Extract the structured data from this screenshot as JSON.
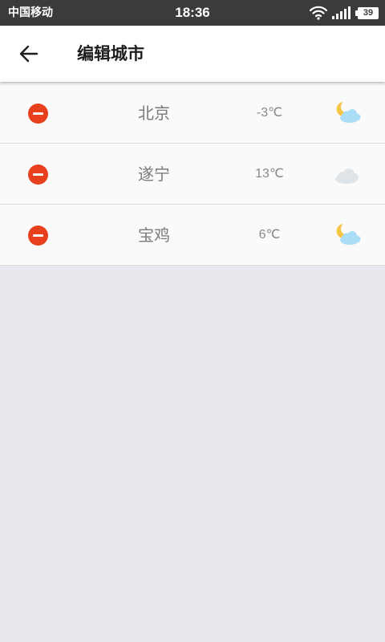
{
  "status_bar": {
    "carrier": "中国移动",
    "time": "18:36",
    "battery": "39"
  },
  "header": {
    "title": "编辑城市"
  },
  "cities": [
    {
      "name": "北京",
      "temp": "-3℃",
      "icon": "moon-cloud-icon"
    },
    {
      "name": "遂宁",
      "temp": "13℃",
      "icon": "cloud-icon"
    },
    {
      "name": "宝鸡",
      "temp": "6℃",
      "icon": "moon-cloud-icon"
    }
  ],
  "colors": {
    "remove": "#e8401c",
    "background": "#e9e8ee",
    "status_bar": "#3b3b3b"
  }
}
